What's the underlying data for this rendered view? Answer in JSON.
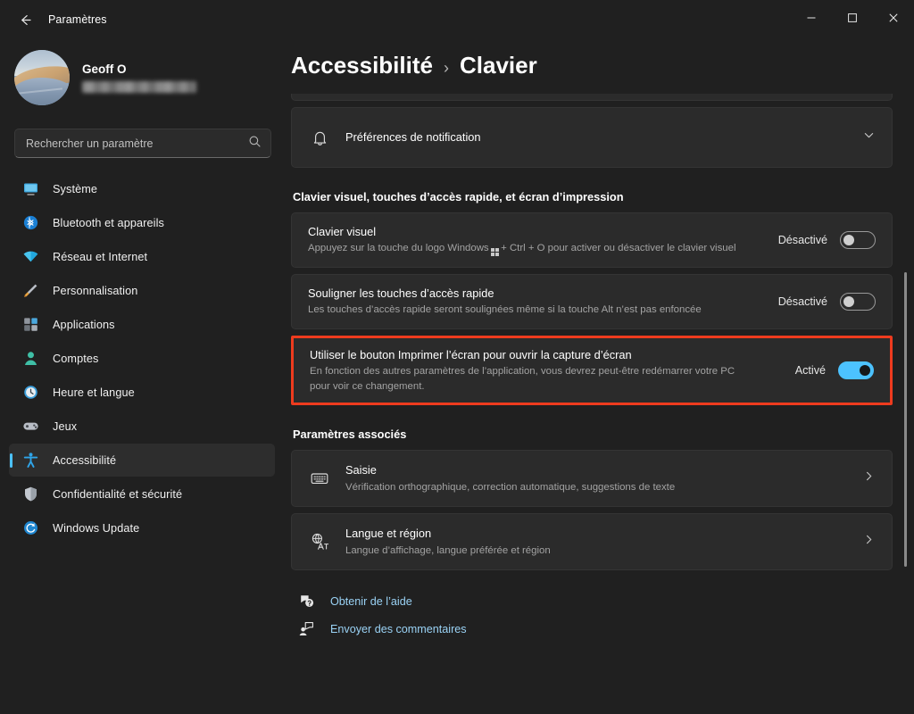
{
  "titlebar": {
    "back_icon": "back-arrow-icon",
    "title": "Paramètres",
    "minimize_label": "—",
    "maximize_label": "□",
    "close_label": "✕"
  },
  "sidebar": {
    "account": {
      "name": "Geoff O",
      "email_masked": ""
    },
    "search": {
      "placeholder": "Rechercher un paramètre",
      "value": "",
      "icon": "search-icon"
    },
    "items": [
      {
        "label": "Système",
        "icon": "monitor-icon",
        "selected": false
      },
      {
        "label": "Bluetooth et appareils",
        "icon": "bluetooth-icon",
        "selected": false
      },
      {
        "label": "Réseau et Internet",
        "icon": "wifi-icon",
        "selected": false
      },
      {
        "label": "Personnalisation",
        "icon": "paintbrush-icon",
        "selected": false
      },
      {
        "label": "Applications",
        "icon": "apps-icon",
        "selected": false
      },
      {
        "label": "Comptes",
        "icon": "person-icon",
        "selected": false
      },
      {
        "label": "Heure et langue",
        "icon": "clock-icon",
        "selected": false
      },
      {
        "label": "Jeux",
        "icon": "gamepad-icon",
        "selected": false
      },
      {
        "label": "Accessibilité",
        "icon": "accessibility-icon",
        "selected": true
      },
      {
        "label": "Confidentialité et sécurité",
        "icon": "shield-icon",
        "selected": false
      },
      {
        "label": "Windows Update",
        "icon": "update-icon",
        "selected": false
      }
    ]
  },
  "content": {
    "breadcrumb": {
      "parent": "Accessibilité",
      "separator": "›",
      "current": "Clavier"
    },
    "notification_card": {
      "title": "Préférences de notification",
      "icon": "bell-icon",
      "expand_icon": "chevron-down-icon"
    },
    "section_keyboard": {
      "heading": "Clavier visuel, touches d’accès rapide, et écran d’impression",
      "rows": [
        {
          "title": "Clavier visuel",
          "sub_before": "Appuyez sur la touche du logo Windows",
          "sub_after": "+ Ctrl + O pour activer ou désactiver le clavier visuel",
          "toggle_label": "Désactivé",
          "toggle_state": "off",
          "highlighted": false
        },
        {
          "title": "Souligner les touches d’accès rapide",
          "sub": "Les touches d’accès rapide seront soulignées même si la touche Alt n’est pas enfoncée",
          "toggle_label": "Désactivé",
          "toggle_state": "off",
          "highlighted": false
        },
        {
          "title": "Utiliser le bouton Imprimer l’écran pour ouvrir la capture d’écran",
          "sub": "En fonction des autres paramètres de l’application, vous devrez peut-être redémarrer votre PC pour voir ce changement.",
          "toggle_label": "Activé",
          "toggle_state": "on",
          "highlighted": true
        }
      ]
    },
    "section_related": {
      "heading": "Paramètres associés",
      "rows": [
        {
          "title": "Saisie",
          "sub": "Vérification orthographique, correction automatique, suggestions de texte",
          "icon": "keyboard-icon",
          "chevron": "chevron-right-icon"
        },
        {
          "title": "Langue et région",
          "sub": "Langue d’affichage, langue préférée et région",
          "icon": "translate-icon",
          "chevron": "chevron-right-icon"
        }
      ]
    },
    "footer": [
      {
        "label": "Obtenir de l’aide",
        "icon": "help-icon"
      },
      {
        "label": "Envoyer des commentaires",
        "icon": "feedback-icon"
      }
    ]
  },
  "colors": {
    "accent": "#4cc2ff",
    "highlight_border": "#ee3b1e",
    "link": "#9ad2f5",
    "window_bg": "#202020",
    "card_bg": "#2b2b2b"
  }
}
